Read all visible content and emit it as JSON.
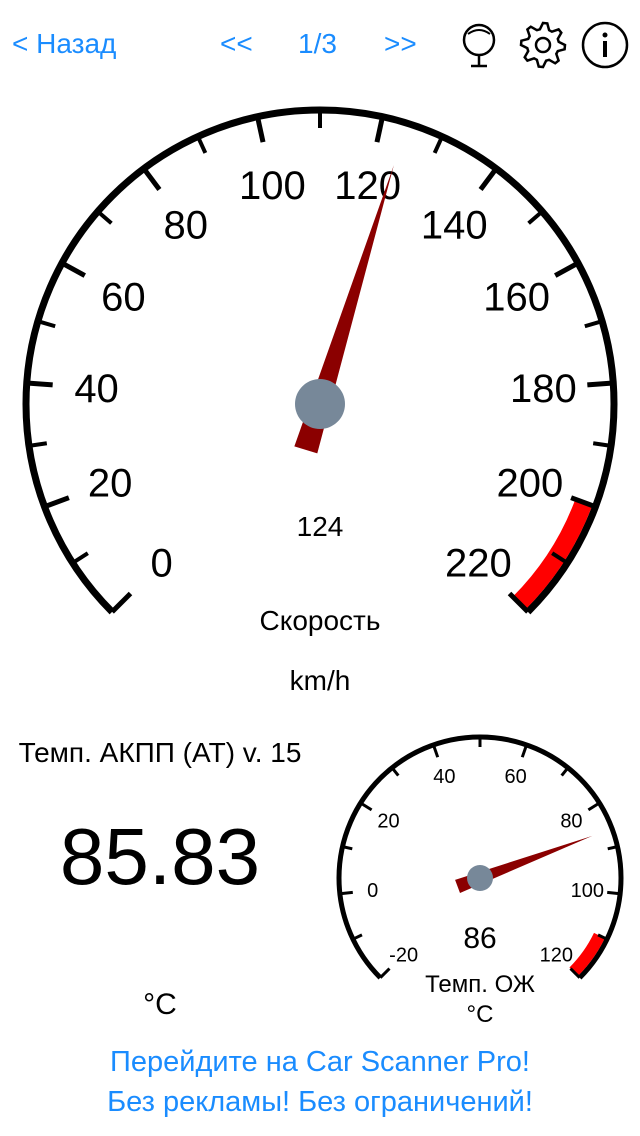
{
  "nav": {
    "back_label": "< Назад",
    "prev_label": "<<",
    "page_label": "1/3",
    "next_label": ">>",
    "icons": [
      "microphone-icon",
      "gear-icon",
      "info-icon"
    ]
  },
  "speed_gauge": {
    "ticks": [
      "0",
      "20",
      "40",
      "60",
      "80",
      "100",
      "120",
      "140",
      "160",
      "180",
      "200",
      "220"
    ],
    "min": 0,
    "max": 220,
    "value": 124,
    "value_label": "124",
    "title": "Скорость",
    "unit": "km/h",
    "redline_from": 200,
    "colors": {
      "needle": "#8b0000",
      "hub": "#778899",
      "redzone": "#ff0000"
    }
  },
  "trans_temp": {
    "title": "Темп. АКПП (AT) v. 15",
    "value": "85.83",
    "unit": "°C"
  },
  "coolant_gauge": {
    "ticks": [
      "-20",
      "0",
      "20",
      "40",
      "60",
      "80",
      "100",
      "120"
    ],
    "min": -20,
    "max": 120,
    "value": 86,
    "value_label": "86",
    "title": "Темп. ОЖ",
    "unit": "°C",
    "redline_from": 110
  },
  "promo": {
    "line1": "Перейдите на Car Scanner Pro!",
    "line2": "Без рекламы! Без ограничений!"
  }
}
